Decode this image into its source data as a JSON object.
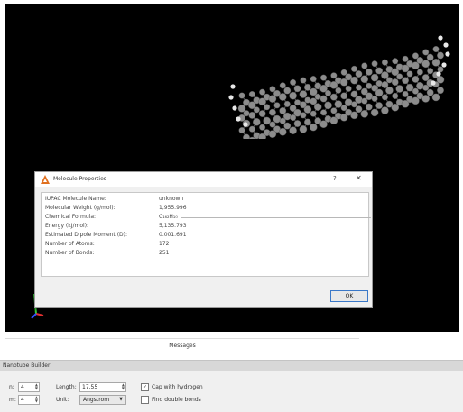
{
  "dialog": {
    "title": "Molecule Properties",
    "help": "?",
    "close": "✕",
    "properties": [
      {
        "label": "IUPAC Molecule Name:",
        "value": "unknown"
      },
      {
        "label": "Molecular Weight (g/mol):",
        "value": "1,955.996"
      },
      {
        "label": "Chemical Formula:",
        "value": "C₁₆₂H₁₀"
      },
      {
        "label": "Energy (kJ/mol):",
        "value": "5,135.793"
      },
      {
        "label": "Estimated Dipole Moment (D):",
        "value": "0.001.691"
      },
      {
        "label": "Number of Atoms:",
        "value": "172"
      },
      {
        "label": "Number of Bonds:",
        "value": "251"
      }
    ],
    "ok_label": "OK"
  },
  "messages": {
    "label": "Messages"
  },
  "builder": {
    "title": "Nanotube Builder",
    "n_label": "n:",
    "n_value": "4",
    "m_label": "m:",
    "m_value": "4",
    "length_label": "Length:",
    "length_value": "17.55",
    "unit_label": "Unit:",
    "unit_value": "Angstrom",
    "cap_label": "Cap with hydrogen",
    "cap_checked": true,
    "periodic_label": "Find double bonds",
    "periodic_checked": false
  },
  "colors": {
    "viewport_bg": "#000000",
    "atom_carbon": "#8c8c8c",
    "atom_hydrogen": "#e8e8e8",
    "accent": "#3a78c8"
  }
}
